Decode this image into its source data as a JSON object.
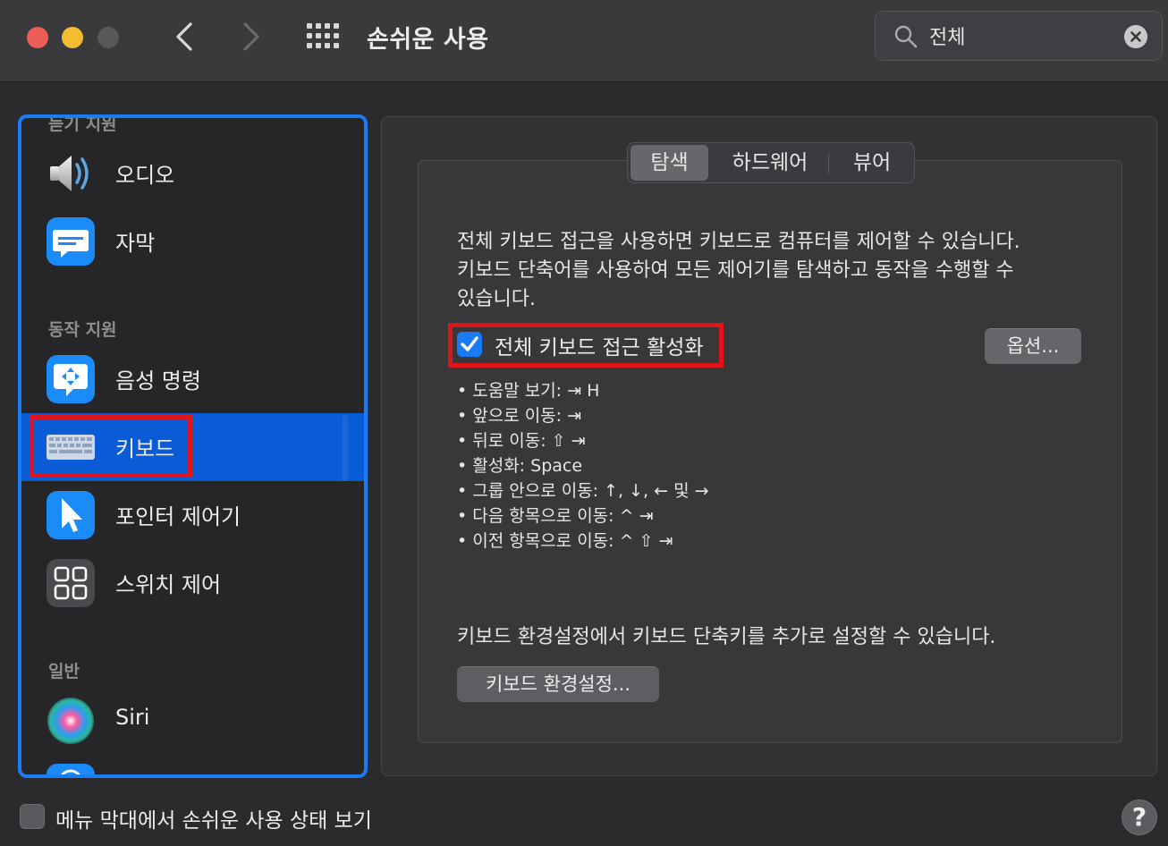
{
  "window": {
    "title": "손쉬운 사용",
    "search_value": "전체"
  },
  "sidebar": {
    "sections": [
      {
        "label": "듣기 지원"
      },
      {
        "label": "동작 지원"
      },
      {
        "label": "일반"
      }
    ],
    "items": [
      {
        "label": "오디오",
        "icon": "speaker-icon"
      },
      {
        "label": "자막",
        "icon": "captions-icon"
      },
      {
        "label": "음성 명령",
        "icon": "voice-control-icon"
      },
      {
        "label": "키보드",
        "icon": "keyboard-icon",
        "selected": true
      },
      {
        "label": "포인터 제어기",
        "icon": "pointer-icon"
      },
      {
        "label": "스위치 제어",
        "icon": "switch-control-icon"
      },
      {
        "label": "Siri",
        "icon": "siri-icon"
      }
    ]
  },
  "tabs": [
    {
      "label": "탐색",
      "active": true
    },
    {
      "label": "하드웨어",
      "active": false
    },
    {
      "label": "뷰어",
      "active": false
    }
  ],
  "content": {
    "description_lines": [
      "전체 키보드 접근을 사용하면 키보드로 컴퓨터를 제어할 수 있습니다.",
      "키보드 단축어를 사용하여 모든 제어기를 탐색하고 동작을 수행할 수",
      "있습니다."
    ],
    "checkbox_label": "전체 키보드 접근 활성화",
    "checkbox_checked": true,
    "options_button": "옵션...",
    "shortcuts": [
      "• 도움말 보기: ⇥ H",
      "• 앞으로 이동: ⇥",
      "• 뒤로 이동: ⇧ ⇥",
      "• 활성화: Space",
      "• 그룹 안으로 이동: ↑, ↓, ← 및 →",
      "• 다음 항목으로 이동: ^ ⇥",
      "• 이전 항목으로 이동: ^ ⇧ ⇥"
    ],
    "footer_note": "키보드 환경설정에서 키보드 단축키를 추가로 설정할 수 있습니다.",
    "preferences_button": "키보드 환경설정..."
  },
  "bottom": {
    "menu_bar_label": "메뉴 막대에서 손쉬운 사용 상태 보기",
    "menu_bar_checked": false,
    "help": "?"
  },
  "colors": {
    "accent": "#1a7cf5",
    "selection": "#0a5bd6",
    "highlight": "#e0141b"
  }
}
